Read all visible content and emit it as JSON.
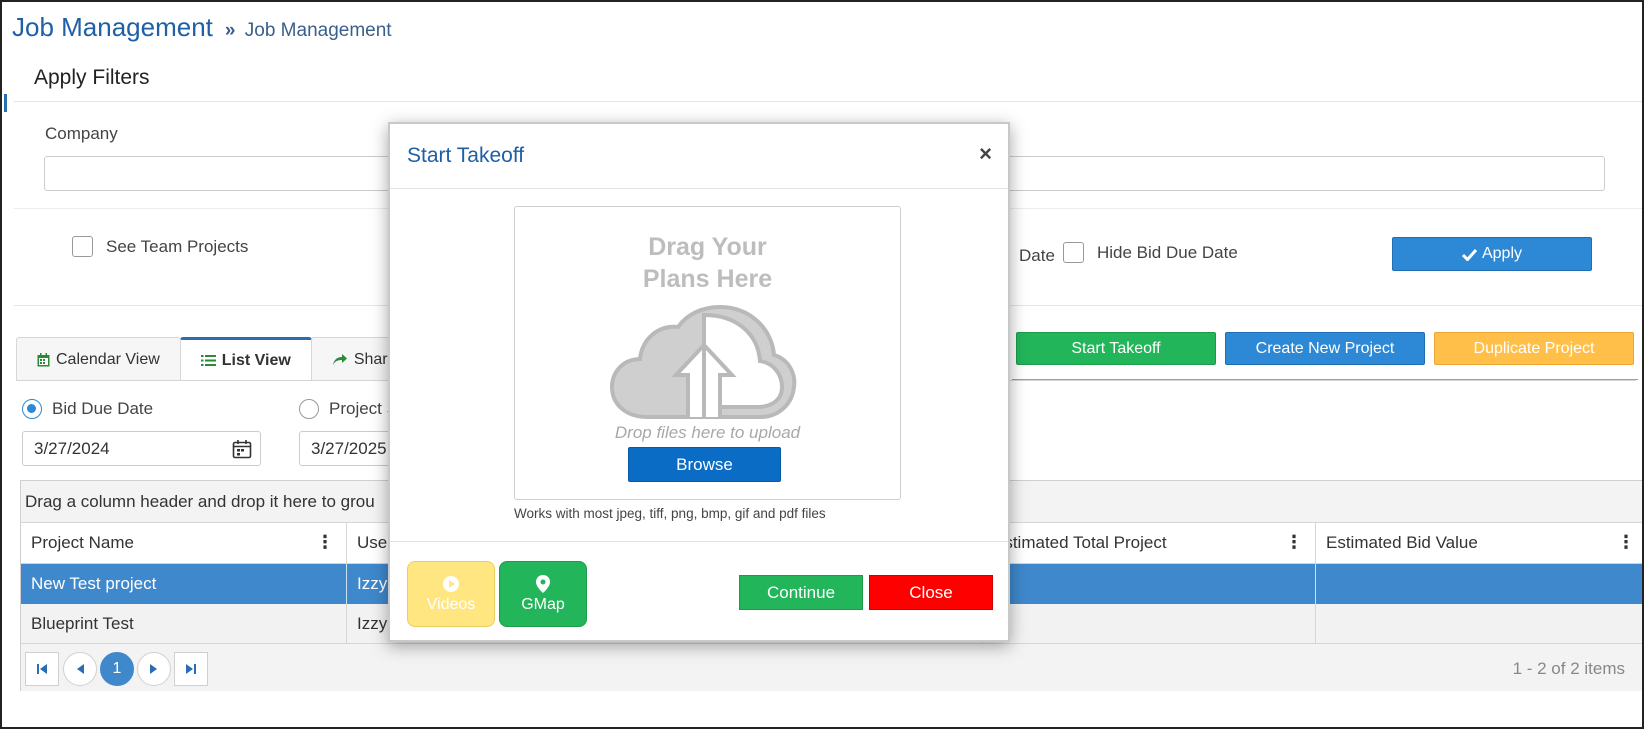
{
  "header": {
    "title": "Job Management",
    "breadcrumb_sep": "»",
    "breadcrumb": "Job Management"
  },
  "filters": {
    "heading": "Apply Filters",
    "company_label": "Company",
    "company_value": "",
    "see_team_projects": "See Team Projects",
    "date_fragment": "Date",
    "hide_bid_due_date": "Hide Bid Due Date",
    "apply_label": "Apply"
  },
  "tabs": [
    {
      "label": "Calendar View",
      "icon": "calendar-icon",
      "active": false
    },
    {
      "label": "List View",
      "icon": "list-icon",
      "active": true
    },
    {
      "label": "Share",
      "icon": "share-icon",
      "active": false
    }
  ],
  "actions": {
    "start_takeoff": "Start Takeoff",
    "create_new_project": "Create New Project",
    "duplicate_project": "Duplicate Project"
  },
  "date_filter": {
    "bid_due_date": "Bid Due Date",
    "project_label_fragment": "Project S",
    "selected": "bid_due_date",
    "from": "3/27/2024",
    "to": "3/27/2025"
  },
  "grid": {
    "group_hint": "Drag a column header and drop it here to grou",
    "columns": [
      "Project Name",
      "User",
      "Estimated Total Project",
      "Estimated Bid Value"
    ],
    "rows": [
      {
        "project_name": "New Test project",
        "user": "Izzy",
        "selected": true
      },
      {
        "project_name": "Blueprint Test",
        "user": "Izzy",
        "selected": false
      }
    ],
    "pager": {
      "current_page": "1",
      "info": "1 - 2 of 2 items"
    }
  },
  "modal": {
    "title": "Start Takeoff",
    "close_glyph": "×",
    "drop_heading_line1": "Drag Your",
    "drop_heading_line2": "Plans Here",
    "drop_sub": "Drop files here to upload",
    "browse": "Browse",
    "formats_note": "Works with most jpeg, tiff, png, bmp, gif and pdf files",
    "videos": "Videos",
    "gmap": "GMap",
    "continue": "Continue",
    "close": "Close"
  },
  "colors": {
    "primary_blue": "#2d88d6",
    "success_green": "#22b55a",
    "warning_orange": "#ffbf49",
    "danger_red": "#ff0000",
    "title_blue": "#1f5fa6",
    "selected_row": "#3f88cc"
  }
}
